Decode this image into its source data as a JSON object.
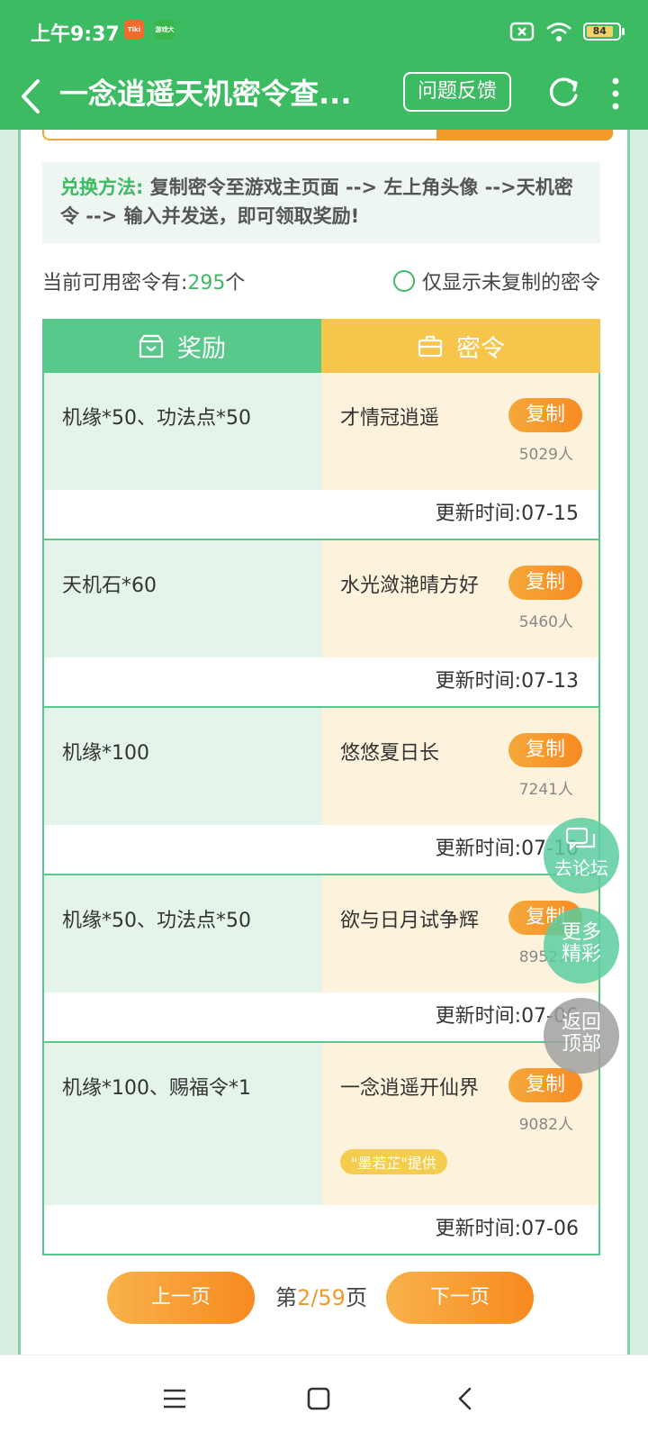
{
  "status": {
    "time": "上午9:37",
    "app_icon_1": "Tiki",
    "app_icon_2": "游戏大玩",
    "battery": "84"
  },
  "header": {
    "title": "一念逍遥天机密令查...",
    "feedback": "问题反馈"
  },
  "howto": {
    "label": "兑换方法:",
    "text": "复制密令至游戏主页面 --> 左上角头像 -->天机密令 --> 输入并发送，即可领取奖励!"
  },
  "count": {
    "prefix": "当前可用密令有:",
    "num": "295",
    "suffix": "个",
    "filter_label": "仅显示未复制的密令"
  },
  "table": {
    "header_reward": "奖励",
    "header_code": "密令",
    "copy_label": "复制",
    "update_prefix": "更新时间:",
    "rows": [
      {
        "reward": "机缘*50、功法点*50",
        "code": "才情冠逍遥",
        "count": "5029人",
        "date": "07-15"
      },
      {
        "reward": "天机石*60",
        "code": "水光潋滟晴方好",
        "count": "5460人",
        "date": "07-13"
      },
      {
        "reward": "机缘*100",
        "code": "悠悠夏日长",
        "count": "7241人",
        "date": "07-10"
      },
      {
        "reward": "机缘*50、功法点*50",
        "code": "欲与日月试争辉",
        "count": "8952人",
        "date": "07-06"
      },
      {
        "reward": "机缘*100、赐福令*1",
        "code": "一念逍遥开仙界",
        "count": "9082人",
        "date": "07-06",
        "provider": "\"墨若芷\"提供"
      }
    ]
  },
  "pager": {
    "prev": "上一页",
    "next": "下一页",
    "pre": "第",
    "current": "2",
    "sep": "/",
    "total": "59",
    "post": "页"
  },
  "floats": {
    "forum": "去论坛",
    "more_1": "更多",
    "more_2": "精彩",
    "top_1": "返回",
    "top_2": "顶部"
  }
}
